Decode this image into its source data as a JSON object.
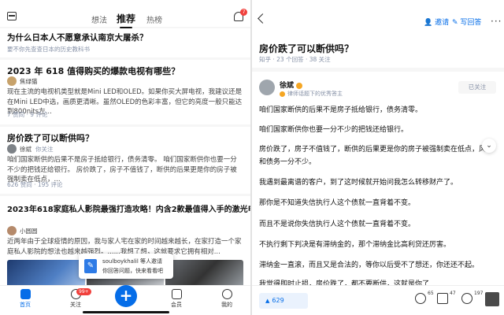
{
  "left": {
    "tabs": [
      "想法",
      "推荐",
      "热榜"
    ],
    "notification_count": "7",
    "cards": [
      {
        "title": "为什么日本人不愿意承认南京大屠杀？",
        "subtitle": "要不你先查查日本的历史教科书"
      },
      {
        "title": "2023 年 618 值得购买的爆款电视有哪些？",
        "author": "焦绿猫",
        "excerpt": "现在主流的电视机类型就是Mini LED和OLED。如果你买大屏电视，我建议还是在Mini LED中选，画质更清晰。虽然OLED的色彩丰富，但它的亮度一般只能达到800nits左...",
        "meta": "7 赞同 · 9 评论"
      },
      {
        "title": "房价跌了可以断供吗？",
        "author": "徐斌",
        "author_tag": "你关注",
        "excerpt": "咱们国家断供的后果不是房子抵给银行，债务清零。 咱们国家断供你也要一分不少的把钱还给银行。 房价跌了，房子不值钱了，断供的后果更是你的房子被强制卖在低点，...",
        "meta": "626 赞同 · 195 评论"
      },
      {
        "title": "2023年618家庭私人影院最强打造攻略！内含2款最值得入手的激光电视推荐~",
        "author": "小圆圆",
        "excerpt": "近两年由于全球疫情的原因，我与家人宅在家的时间越来越长，在家打造一个家庭私人影院的想法也越来越强烈。......我想了想，这就要求它拥有相对..."
      }
    ],
    "toast": {
      "line1": "soulboykhalil  等人邀请",
      "line2": "你回答问题，快来看看吧"
    },
    "nav": {
      "home": "首页",
      "follow": "关注",
      "follow_badge": "99+",
      "add": "+",
      "member": "会员",
      "me": "我的"
    }
  },
  "right": {
    "actions": {
      "invite": "邀请",
      "write": "写回答",
      "more": "···"
    },
    "title": "房价跌了可以断供吗？",
    "meta": "知乎 · 23 个回答 · 38 关注",
    "answerer": {
      "name": "徐斌",
      "credential": "律师话题下的优秀答主",
      "follow_state": "已关注"
    },
    "paragraphs": [
      "咱们国家断供的后果不是房子抵给银行，债务清零。",
      "咱们国家断供你也要一分不少的把钱还给银行。",
      "房价跌了，房子不值钱了，断供的后果更是你的房子被强制卖在低点，风险和债务一分不少。",
      "我遇到最离谱的客户，到了这时候就开始问我怎么转移财产了。",
      "那你是不知道失信执行人这个债就一直背着不变。",
      "而且不是说你失信执行人这个债就一直背着不变。",
      "不执行剩下判决是有滞纳金的，那个滞纳金比高利贷还厉害。",
      "滞纳金一直滚，而且又是合法的，等你以后受不了想还，你还还不起。",
      "我觉得即时止损，房价跌了，都不要断供，这就是你了"
    ],
    "bottom": {
      "votes": "629",
      "comments": "65",
      "favorites": "47",
      "likes": "197",
      "vote_arrow": "▲"
    }
  },
  "colors": {
    "accent": "#056de8",
    "badge": "#f1403c"
  }
}
